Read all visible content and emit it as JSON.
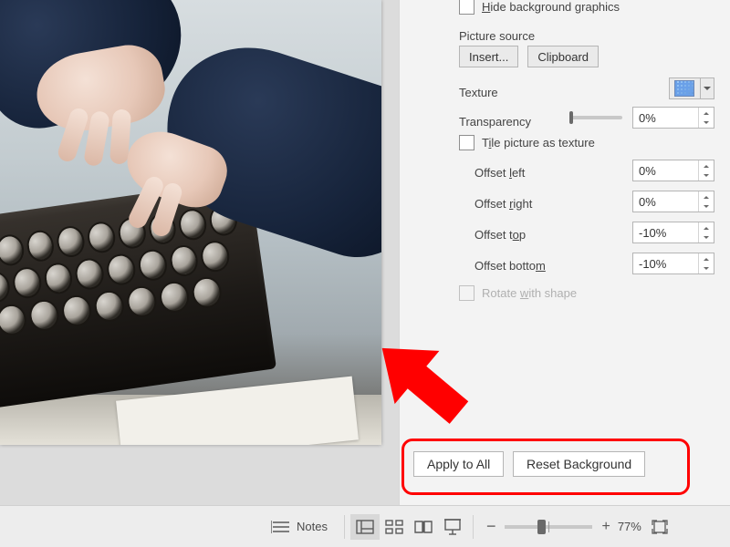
{
  "hide_bg_graphics_label_pre": "H",
  "hide_bg_graphics_label_post": "ide background graphics",
  "picture_source_label": "Picture source",
  "insert_label": "Insert...",
  "clipboard_label": "Clipboard",
  "texture_label_pre": "Te",
  "texture_label_ul": "x",
  "texture_label_post": "ture",
  "transparency_label_ul": "T",
  "transparency_label_post": "ransparency",
  "transparency_value": "0%",
  "tile_label_pre": "T",
  "tile_label_ul": "i",
  "tile_label_post": "le picture as texture",
  "offset_left_label_pre": "Offset ",
  "offset_left_label_ul": "l",
  "offset_left_label_post": "eft",
  "offset_left_value": "0%",
  "offset_right_label_pre": "Offset ",
  "offset_right_label_ul": "r",
  "offset_right_label_post": "ight",
  "offset_right_value": "0%",
  "offset_top_label_pre": "Offset t",
  "offset_top_label_ul": "o",
  "offset_top_label_post": "p",
  "offset_top_value": "-10%",
  "offset_bottom_label_pre": "Offset botto",
  "offset_bottom_label_ul": "m",
  "offset_bottom_label_post": "",
  "offset_bottom_value": "-10%",
  "rotate_label_pre": "Rotate ",
  "rotate_label_ul": "w",
  "rotate_label_post": "ith shape",
  "apply_all_label": "Apply to All",
  "reset_bg_label_pre": "Reset ",
  "reset_bg_label_ul": "B",
  "reset_bg_label_post": "ackground",
  "notes_label": "Notes",
  "zoom_value": "77%"
}
